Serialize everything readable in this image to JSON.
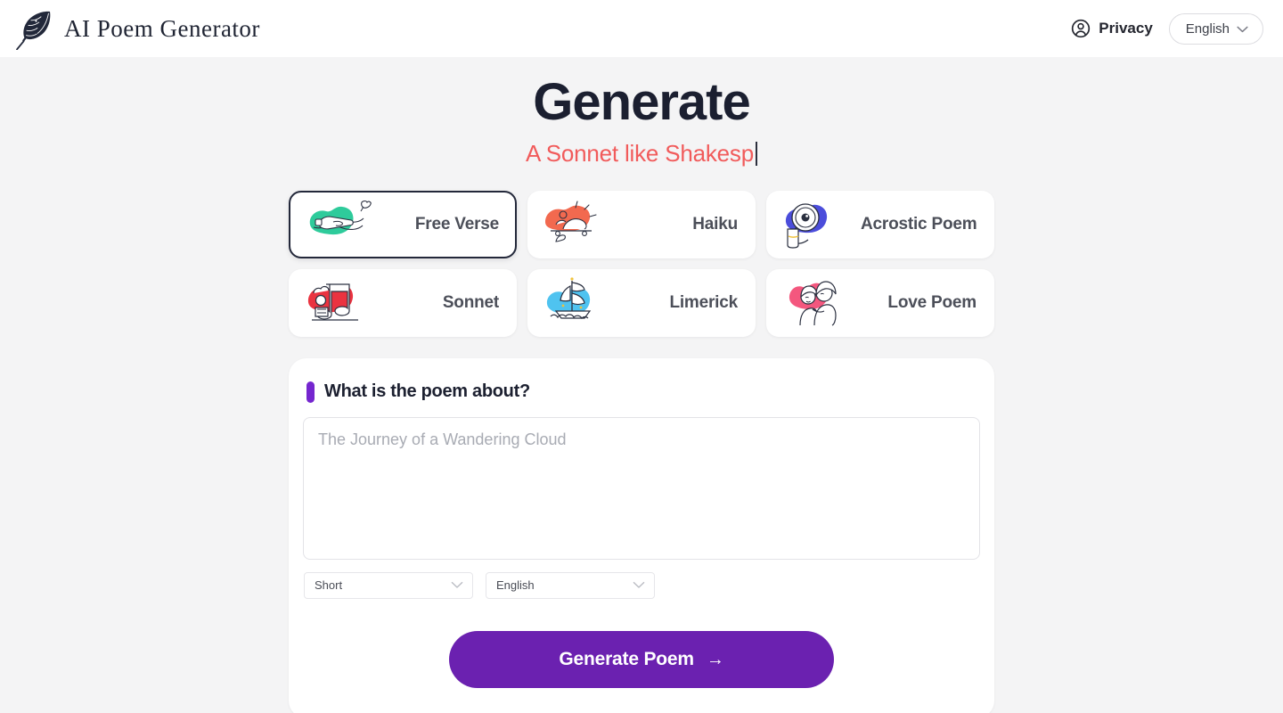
{
  "header": {
    "brand_name": "AI Poem Generator",
    "brand_icon": "feather-quill-icon",
    "privacy_label": "Privacy",
    "privacy_icon": "user-circle-icon",
    "language_value": "English",
    "language_chevron": "chevron-down-icon"
  },
  "hero": {
    "title": "Generate",
    "subtitle": "A Sonnet like Shakesp",
    "subtitle_color": "#f15b5b",
    "title_color": "#1b1f30",
    "caret_visible": true
  },
  "poem_types": [
    {
      "label": "Free Verse",
      "selected": true,
      "blob_color": "#2ecb9b",
      "art": "message-in-bottle-icon"
    },
    {
      "label": "Haiku",
      "selected": false,
      "blob_color": "#f2694f",
      "art": "sleeping-figure-icon"
    },
    {
      "label": "Acrostic Poem",
      "selected": false,
      "blob_color": "#4b4ddb",
      "art": "magnifying-glass-icon"
    },
    {
      "label": "Sonnet",
      "selected": false,
      "blob_color": "#ea3340",
      "art": "chef-music-note-icon"
    },
    {
      "label": "Limerick",
      "selected": false,
      "blob_color": "#4fc3f0",
      "art": "sailing-ship-icon"
    },
    {
      "label": "Love Poem",
      "selected": false,
      "blob_color": "#f4577e",
      "art": "couple-icon"
    }
  ],
  "form": {
    "section_title": "What is the poem about?",
    "accent_color": "#7526cf",
    "prompt_placeholder": "The Journey of a Wandering Cloud",
    "prompt_value": "",
    "length_value": "Short",
    "language_value": "English",
    "select_chevron": "chevron-down-icon",
    "submit_label": "Generate Poem",
    "submit_arrow": "→",
    "submit_color": "#6b21b0"
  }
}
